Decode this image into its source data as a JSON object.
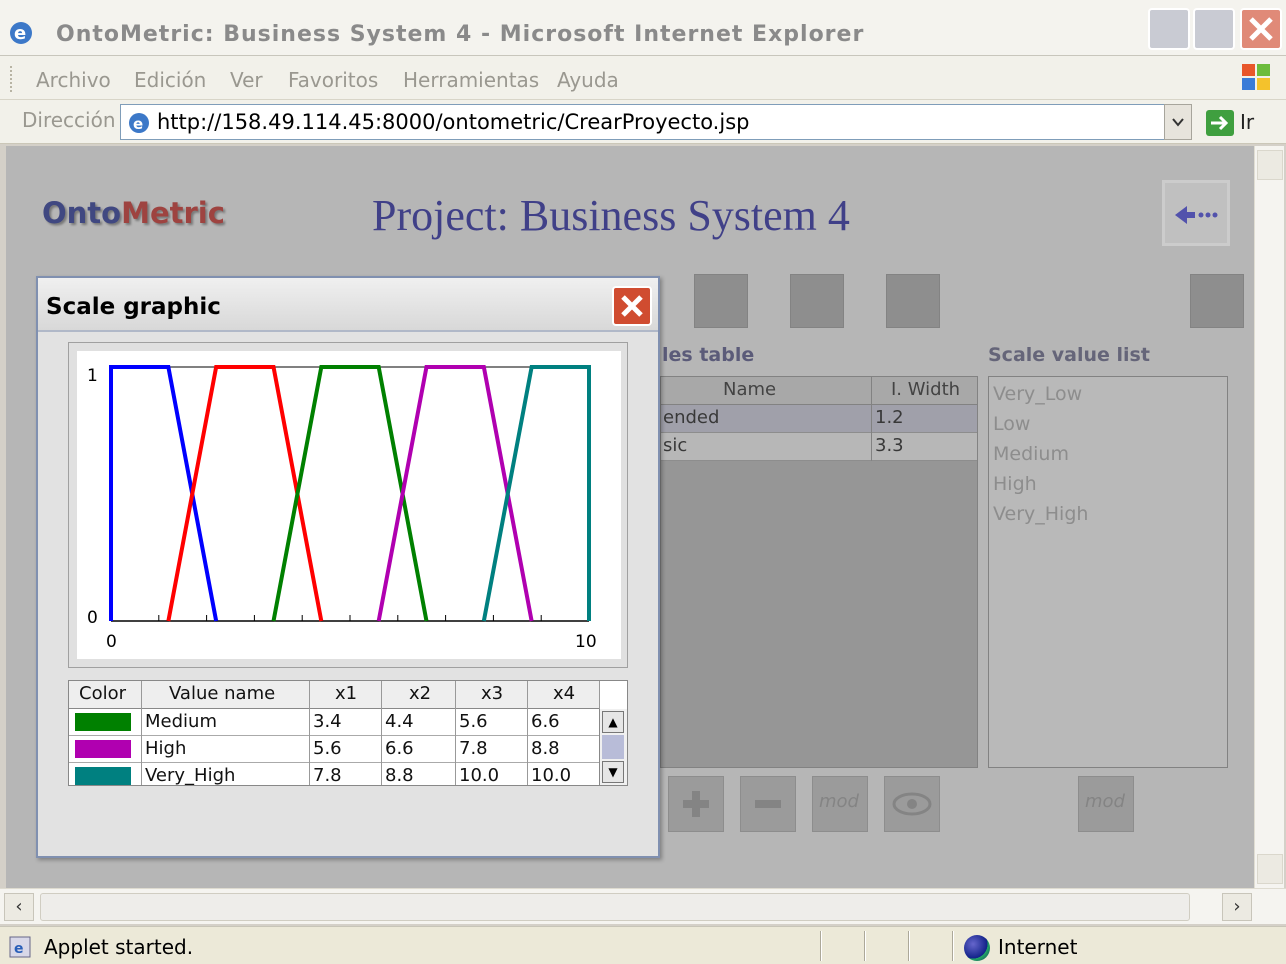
{
  "window": {
    "title": "OntoMetric: Business System 4 - Microsoft Internet Explorer"
  },
  "menu": [
    "Archivo",
    "Edición",
    "Ver",
    "Favoritos",
    "Herramientas",
    "Ayuda"
  ],
  "address": {
    "label": "Dirección",
    "url": "http://158.49.114.45:8000/ontometric/CrearProyecto.jsp",
    "go_label": "Ir"
  },
  "page": {
    "logo_a": "Onto",
    "logo_b": "Metric",
    "title": "Project: Business System 4",
    "scales_table_label": "les table",
    "scales_table": {
      "headers": [
        "Name",
        "I. Width"
      ],
      "rows": [
        [
          "ended",
          "1.2"
        ],
        [
          "sic",
          "3.3"
        ]
      ]
    },
    "scale_value_list_label": "Scale value list",
    "scale_values": [
      "Very_Low",
      "Low",
      "Medium",
      "High",
      "Very_High"
    ],
    "mod_label": "mod"
  },
  "dialog": {
    "title": "Scale graphic",
    "table": {
      "headers": [
        "Color",
        "Value name",
        "x1",
        "x2",
        "x3",
        "x4"
      ],
      "rows": [
        {
          "color": "#008000",
          "name": "Medium",
          "x1": "3.4",
          "x2": "4.4",
          "x3": "5.6",
          "x4": "6.6"
        },
        {
          "color": "#b000b0",
          "name": "High",
          "x1": "5.6",
          "x2": "6.6",
          "x3": "7.8",
          "x4": "8.8"
        },
        {
          "color": "#008080",
          "name": "Very_High",
          "x1": "7.8",
          "x2": "8.8",
          "x3": "10.0",
          "x4": "10.0"
        }
      ]
    }
  },
  "chart_data": {
    "type": "line",
    "x_tick_labels": [
      "0",
      "10"
    ],
    "y_tick_labels": [
      "0",
      "1"
    ],
    "xlim": [
      0,
      10
    ],
    "ylim": [
      0,
      1
    ],
    "series": [
      {
        "color": "#0000ff",
        "x": [
          0.0,
          0.0,
          1.2,
          2.2
        ],
        "y": [
          0,
          1,
          1,
          0
        ]
      },
      {
        "color": "#ff0000",
        "x": [
          1.2,
          2.2,
          3.4,
          4.4
        ],
        "y": [
          0,
          1,
          1,
          0
        ]
      },
      {
        "color": "#008000",
        "x": [
          3.4,
          4.4,
          5.6,
          6.6
        ],
        "y": [
          0,
          1,
          1,
          0
        ]
      },
      {
        "color": "#b000b0",
        "x": [
          5.6,
          6.6,
          7.8,
          8.8
        ],
        "y": [
          0,
          1,
          1,
          0
        ]
      },
      {
        "color": "#008080",
        "x": [
          7.8,
          8.8,
          10.0,
          10.0
        ],
        "y": [
          0,
          1,
          1,
          0
        ]
      }
    ]
  },
  "status": {
    "message": "Applet started.",
    "zone": "Internet"
  }
}
